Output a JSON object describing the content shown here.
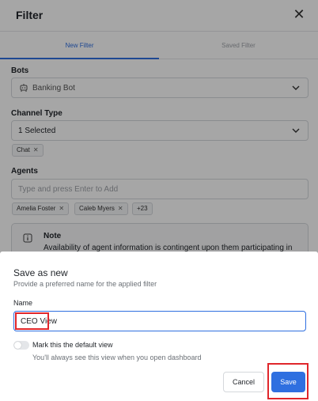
{
  "filter_panel": {
    "title": "Filter",
    "close_icon": "close-icon",
    "tabs": [
      {
        "label": "New Filter",
        "active": true
      },
      {
        "label": "Saved Filter",
        "active": false
      }
    ],
    "bots": {
      "label": "Bots",
      "icon": "bot-icon",
      "selected": "Banking Bot"
    },
    "channel_type": {
      "label": "Channel Type",
      "selected": "1 Selected",
      "chips": [
        "Chat"
      ]
    },
    "agents": {
      "label": "Agents",
      "placeholder": "Type and press Enter to Add",
      "chips": [
        "Amelia Foster",
        "Caleb Myers"
      ],
      "more": "+23"
    },
    "note": {
      "icon": "info-icon",
      "title": "Note",
      "text": "Availability of agent information is contingent upon them participating in"
    }
  },
  "save_dialog": {
    "title": "Save as new",
    "subtitle": "Provide a preferred name for the applied filter",
    "name_label": "Name",
    "name_value": "CEO View",
    "default_toggle": {
      "label": "Mark this the default view",
      "description": "You'll always see this view when you open dashboard",
      "on": false
    },
    "cancel_label": "Cancel",
    "save_label": "Save"
  },
  "colors": {
    "accent": "#2f6fe0",
    "highlight": "#e0262b",
    "overlay": "rgba(0,0,0,0.35)"
  }
}
